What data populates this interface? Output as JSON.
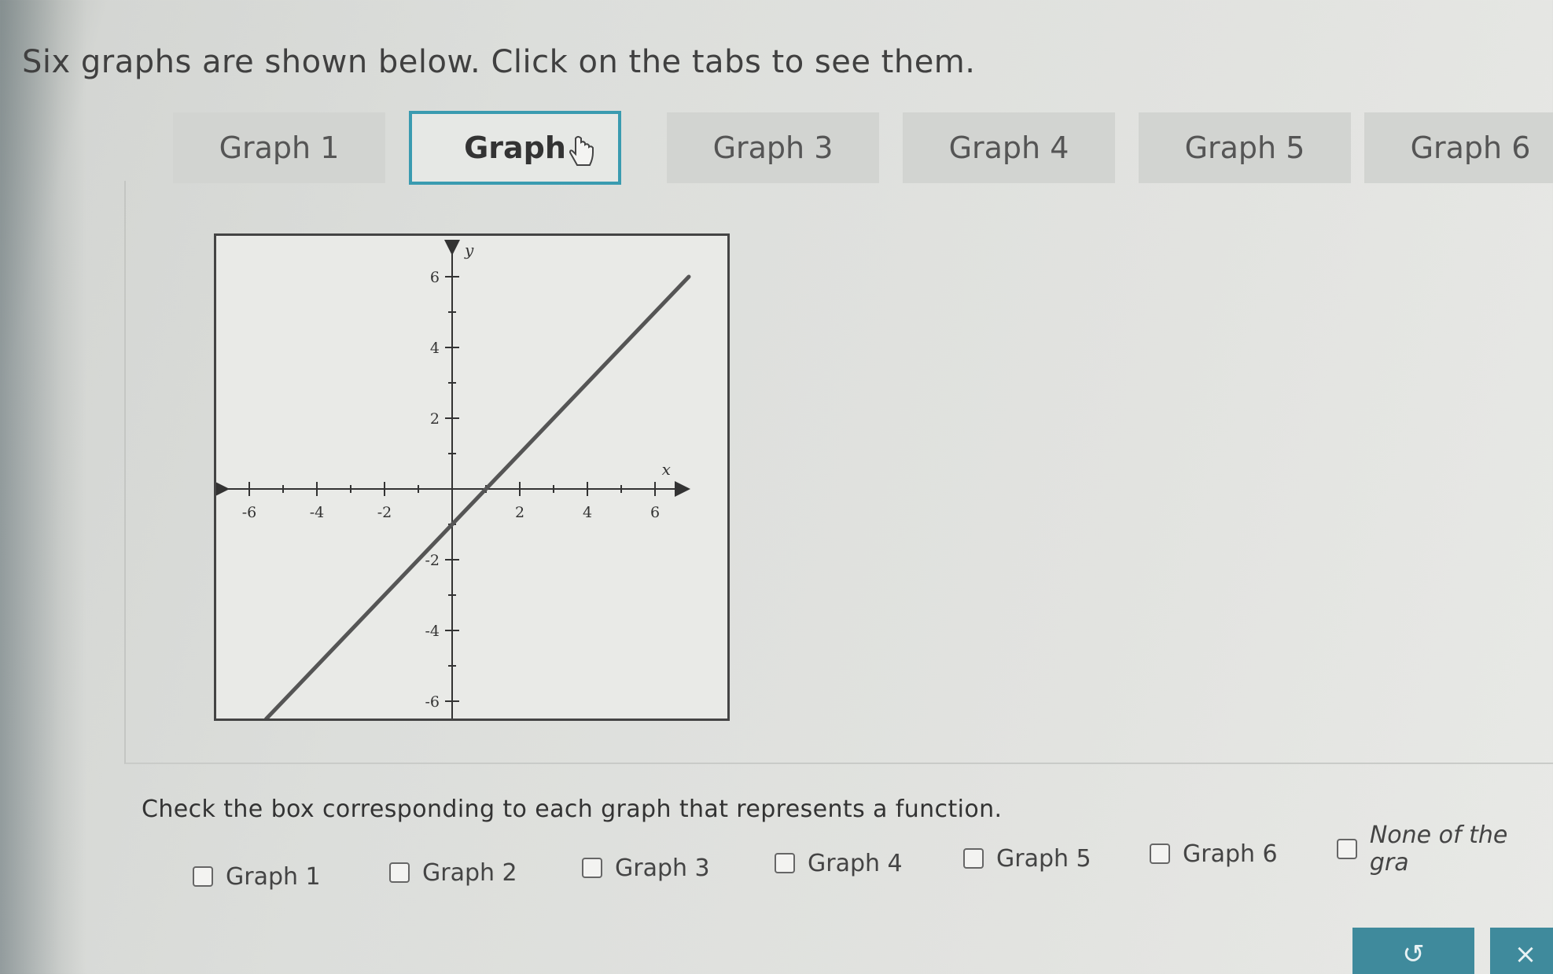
{
  "prompt": "Six graphs are shown below. Click on the tabs to see them.",
  "tabs": [
    {
      "label": "Graph 1",
      "active": false
    },
    {
      "label": "Graph",
      "active": true
    },
    {
      "label": "Graph 3",
      "active": false
    },
    {
      "label": "Graph 4",
      "active": false
    },
    {
      "label": "Graph 5",
      "active": false
    },
    {
      "label": "Graph 6",
      "active": false
    }
  ],
  "graph": {
    "x_axis_label": "x",
    "y_axis_label": "y",
    "x_tick_labels": [
      "-6",
      "-4",
      "-2",
      "2",
      "4",
      "6"
    ],
    "y_tick_labels": [
      "6",
      "4",
      "2",
      "-2",
      "-4",
      "-6"
    ],
    "line_color": "#555555"
  },
  "chart_data": {
    "type": "line",
    "xlim": [
      -7,
      7
    ],
    "ylim": [
      -7,
      7
    ],
    "series": [
      {
        "x": [
          -5.5,
          7
        ],
        "y": [
          -6.5,
          6
        ]
      }
    ],
    "grid": false
  },
  "check_prompt": "Check the box corresponding to each graph that represents a function.",
  "options": [
    {
      "label": "Graph 1",
      "checked": false
    },
    {
      "label": "Graph 2",
      "checked": false
    },
    {
      "label": "Graph 3",
      "checked": false
    },
    {
      "label": "Graph 4",
      "checked": false
    },
    {
      "label": "Graph 5",
      "checked": false
    },
    {
      "label": "Graph 6",
      "checked": false
    },
    {
      "label": "None of the gra",
      "checked": false
    }
  ],
  "buttons": {
    "undo_icon": "undo-icon",
    "close_icon": "close-icon",
    "undo_glyph": "↺",
    "close_glyph": "×"
  },
  "colors": {
    "accent": "#3a9bb0",
    "button": "#3f8a9c"
  }
}
